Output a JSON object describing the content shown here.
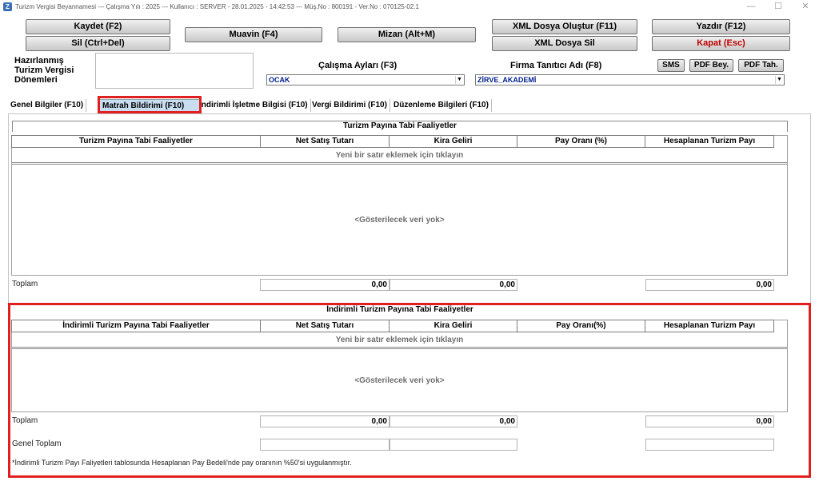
{
  "window": {
    "title": "Turizm Vergisi Beyannamesi  ---  Çalışma Yılı : 2025  ---  Kullanıcı : SERVER - 28.01.2025 - 14:42:53  ---  Müş.No : 800191  - Ver.No : 070125-02.1",
    "icon_letter": "Z",
    "minimize": "—",
    "maximize": "☐",
    "close": "✕"
  },
  "toolbar": {
    "save": "Kaydet (F2)",
    "delete": "Sil (Ctrl+Del)",
    "muavin": "Muavin (F4)",
    "mizan": "Mizan (Alt+M)",
    "xml_create": "XML Dosya Oluştur (F11)",
    "xml_delete": "XML Dosya Sil",
    "print": "Yazdır (F12)",
    "close": "Kapat (Esc)",
    "sms": "SMS",
    "pdf_bey": "PDF Bey.",
    "pdf_tah": "PDF Tah."
  },
  "periods_label": "Hazırlanmış Turizm Vergisi Dönemleri",
  "working_months": {
    "label": "Çalışma Ayları (F3)",
    "value": "OCAK"
  },
  "firm": {
    "label": "Firma Tanıtıcı Adı (F8)",
    "value": "ZİRVE_AKADEMİ"
  },
  "tabs": [
    "Genel Bilgiler (F10)",
    "Matrah Bildirimi (F10)",
    "İndirimli İşletme Bilgisi (F10)",
    "Vergi Bildirimi (F10)",
    "Düzenleme Bilgileri (F10)"
  ],
  "section1": {
    "title": "Turizm Payına Tabi Faaliyetler",
    "columns": [
      "Turizm Payına Tabi Faaliyetler",
      "Net Satış Tutarı",
      "Kira Geliri",
      "Pay Oranı (%)",
      "Hesaplanan Turizm Payı"
    ],
    "new_row": "Yeni bir satır eklemek için tıklayın",
    "no_data": "<Gösterilecek veri yok>",
    "total_label": "Toplam",
    "totals": [
      "0,00",
      "0,00",
      "0,00"
    ]
  },
  "section2": {
    "title": "İndirimli Turizm Payına Tabi Faaliyetler",
    "columns": [
      "İndirimli Turizm Payına Tabi Faaliyetler",
      "Net Satış Tutarı",
      "Kira Geliri",
      "Pay Oranı(%)",
      "Hesaplanan Turizm Payı"
    ],
    "new_row": "Yeni bir satır eklemek için tıklayın",
    "no_data": "<Gösterilecek veri yok>",
    "total_label": "Toplam",
    "totals": [
      "0,00",
      "0,00",
      "0,00"
    ],
    "grand_total_label": "Genel Toplam",
    "footnote": "*İndirimli Turizm Payı Faliyetleri tablosunda Hesaplanan Pay Bedeli'nde pay oranının %50'si uygulanmıştır."
  },
  "colors": {
    "highlight": "#e02020",
    "close_text": "#c00000",
    "combo_text": "#001f8c"
  }
}
